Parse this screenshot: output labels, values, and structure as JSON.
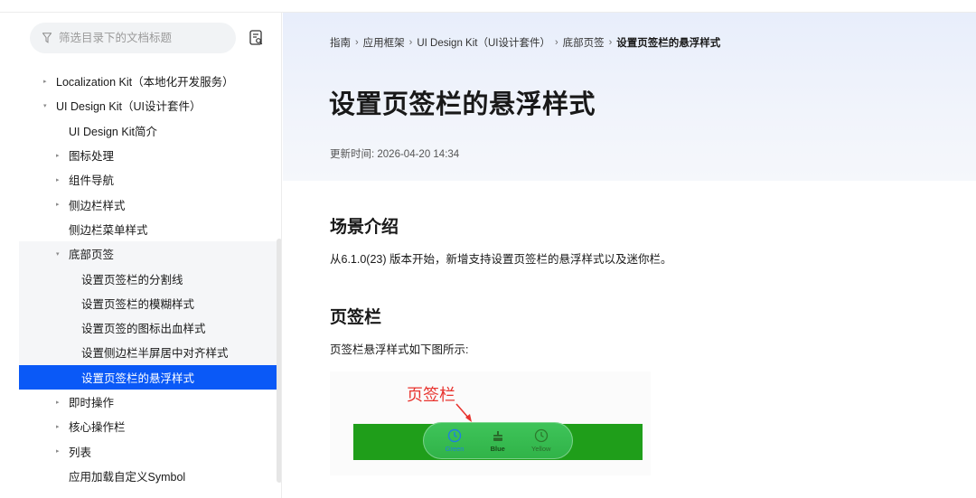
{
  "sidebar": {
    "filter_placeholder": "筛选目录下的文档标题",
    "items": [
      {
        "label": "Localization Kit（本地化开发服务）",
        "level": 0,
        "caret": "▸"
      },
      {
        "label": "UI Design Kit（UI设计套件）",
        "level": 0,
        "caret": "▾"
      },
      {
        "label": "UI Design Kit简介",
        "level": "1-leaf",
        "caret": ""
      },
      {
        "label": "图标处理",
        "level": 1,
        "caret": "▸"
      },
      {
        "label": "组件导航",
        "level": 1,
        "caret": "▸"
      },
      {
        "label": "侧边栏样式",
        "level": 1,
        "caret": "▸"
      },
      {
        "label": "侧边栏菜单样式",
        "level": "1-leaf",
        "caret": ""
      },
      {
        "label": "底部页签",
        "level": 1,
        "caret": "▾"
      },
      {
        "label": "设置页签栏的分割线",
        "level": "2-leaf",
        "caret": ""
      },
      {
        "label": "设置页签栏的模糊样式",
        "level": "2-leaf",
        "caret": ""
      },
      {
        "label": "设置页签的图标出血样式",
        "level": "2-leaf",
        "caret": ""
      },
      {
        "label": "设置侧边栏半屏居中对齐样式",
        "level": "2-leaf",
        "caret": ""
      },
      {
        "label": "设置页签栏的悬浮样式",
        "level": "2-leaf",
        "caret": "",
        "active": true
      },
      {
        "label": "即时操作",
        "level": 1,
        "caret": "▸"
      },
      {
        "label": "核心操作栏",
        "level": 1,
        "caret": "▸"
      },
      {
        "label": "列表",
        "level": 1,
        "caret": "▸"
      },
      {
        "label": "应用加载自定义Symbol",
        "level": "1-leaf",
        "caret": ""
      }
    ]
  },
  "breadcrumb": {
    "items": [
      "指南",
      "应用框架",
      "UI Design Kit（UI设计套件）",
      "底部页签"
    ],
    "current": "设置页签栏的悬浮样式",
    "separator": "›"
  },
  "article": {
    "title": "设置页签栏的悬浮样式",
    "update_time": "更新时间: 2026-04-20 14:34",
    "section1_heading": "场景介绍",
    "section1_text": "从6.1.0(23) 版本开始，新增支持设置页签栏的悬浮样式以及迷你栏。",
    "section2_heading": "页签栏",
    "section2_text": "页签栏悬浮样式如下图所示:"
  },
  "figure": {
    "annotation": "页签栏",
    "tabs": [
      {
        "label": "Green",
        "icon": "clock-icon"
      },
      {
        "label": "Blue",
        "icon": "cake-icon"
      },
      {
        "label": "Yellow",
        "icon": "clock-icon"
      }
    ]
  },
  "colors": {
    "accent": "#0a59f7",
    "annotation": "#e8342f",
    "figure_bar": "#1f9e1a"
  }
}
